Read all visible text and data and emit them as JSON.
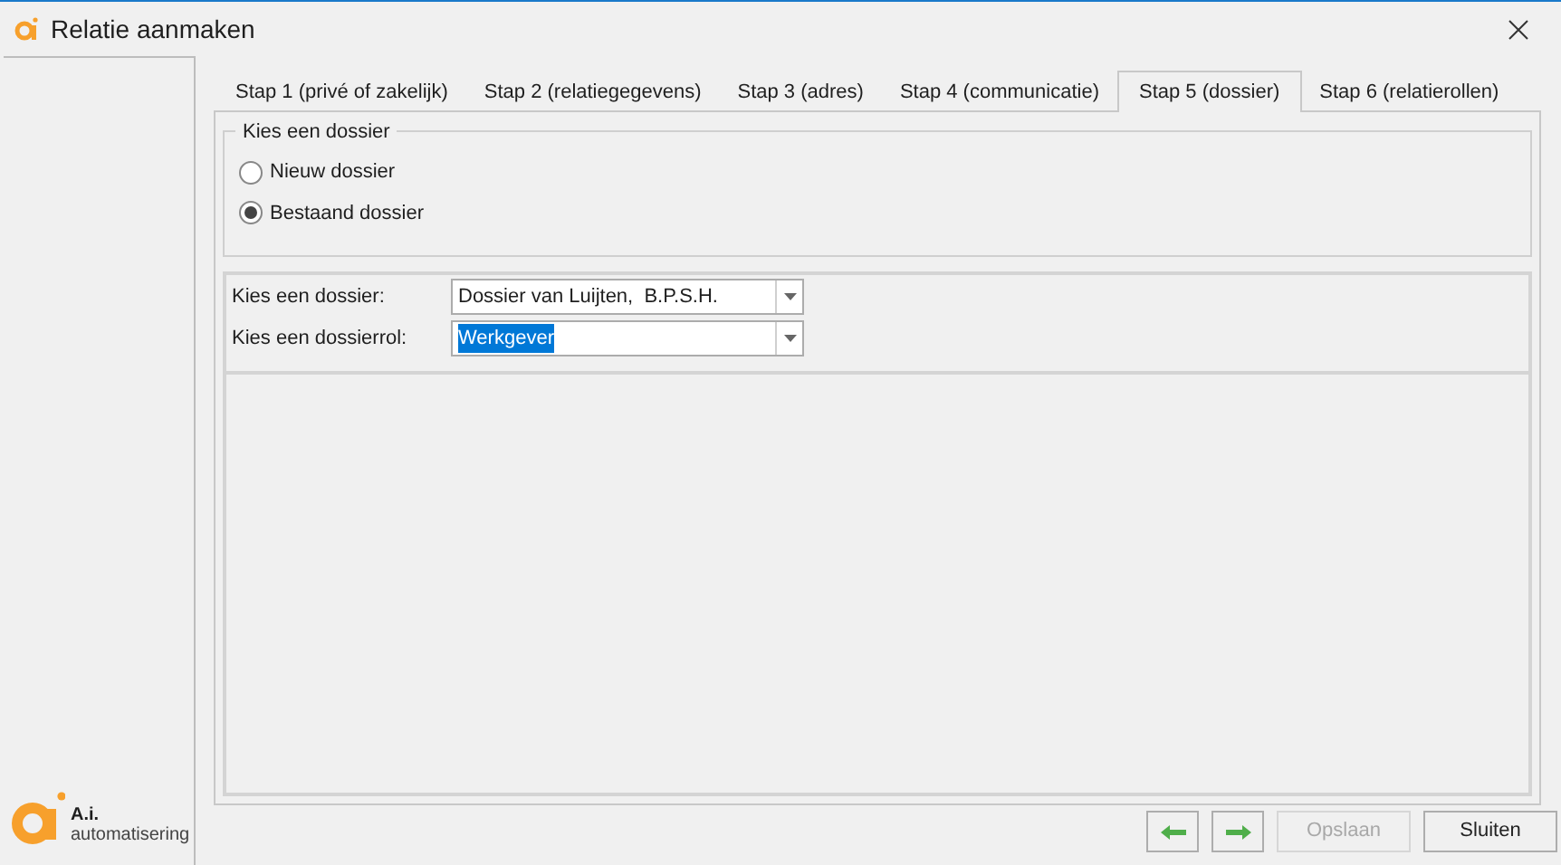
{
  "window": {
    "title": "Relatie aanmaken"
  },
  "brand": {
    "name": "A.i.",
    "subtitle": "automatisering"
  },
  "tabs": [
    {
      "label": "Stap 1 (privé of zakelijk)",
      "selected": false
    },
    {
      "label": "Stap 2 (relatiegegevens)",
      "selected": false
    },
    {
      "label": "Stap 3 (adres)",
      "selected": false
    },
    {
      "label": "Stap 4 (communicatie)",
      "selected": false
    },
    {
      "label": "Stap 5 (dossier)",
      "selected": true
    },
    {
      "label": "Stap 6 (relatierollen)",
      "selected": false
    }
  ],
  "group": {
    "title": "Kies een dossier",
    "options": [
      {
        "label": "Nieuw dossier",
        "selected": false
      },
      {
        "label": "Bestaand dossier",
        "selected": true
      }
    ]
  },
  "fields": [
    {
      "label": "Kies een dossier:",
      "value": "Dossier van Luijten,  B.P.S.H.",
      "text_selected": false
    },
    {
      "label": "Kies een dossierrol:",
      "value": "Werkgever",
      "text_selected": true
    }
  ],
  "buttons": [
    {
      "kind": "back",
      "disabled": false
    },
    {
      "kind": "forward",
      "disabled": false
    },
    {
      "kind": "text",
      "label": "Opslaan",
      "disabled": true
    },
    {
      "kind": "text",
      "label": "Sluiten",
      "disabled": false
    }
  ]
}
